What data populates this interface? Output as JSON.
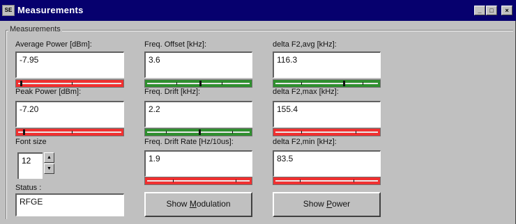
{
  "window": {
    "title": "Measurements",
    "icon_name": "app-icon",
    "controls": [
      "minimize",
      "maximize",
      "close"
    ]
  },
  "group": {
    "label": "Measurements"
  },
  "col1": {
    "avg_power_label": "Average Power [dBm]:",
    "avg_power_value": "-7.95",
    "peak_power_label": "Peak Power [dBm]:",
    "peak_power_value": "-7.20",
    "font_size_label": "Font size",
    "font_size_value": "12",
    "status_label": "Status :",
    "status_value": "RFGE"
  },
  "col2": {
    "freq_offset_label": "Freq. Offset [kHz]:",
    "freq_offset_value": "3.6",
    "freq_drift_label": "Freq. Drift [kHz]:",
    "freq_drift_value": "2.2",
    "freq_drift_rate_label": "Freq. Drift Rate [Hz/10us]:",
    "freq_drift_rate_value": "1.9",
    "show_modulation_prefix": "Show ",
    "show_modulation_accel": "M",
    "show_modulation_suffix": "odulation"
  },
  "col3": {
    "delta_avg_label": "delta F2,avg [kHz]:",
    "delta_avg_value": "116.3",
    "delta_max_label": "delta F2,max [kHz]:",
    "delta_max_value": "155.4",
    "delta_min_label": "delta F2,min [kHz]:",
    "delta_min_value": "83.5",
    "show_power_prefix": "Show ",
    "show_power_accel": "P",
    "show_power_suffix": "ower"
  },
  "indicators": {
    "avg_power": {
      "status": "fail",
      "color": "#f03030",
      "level": 0.02
    },
    "peak_power": {
      "status": "fail",
      "color": "#f03030",
      "level": 0.03
    },
    "freq_offset": {
      "status": "pass",
      "color": "#2f8f2f",
      "level": 0.52
    },
    "freq_drift": {
      "status": "pass",
      "color": "#2f8f2f",
      "level": 0.51
    },
    "freq_drift_rate": {
      "status": "fail",
      "color": "#f03030"
    },
    "delta_avg": {
      "status": "pass",
      "color": "#2f8f2f",
      "level": 0.65
    },
    "delta_max": {
      "status": "fail",
      "color": "#f03030"
    },
    "delta_min": {
      "status": "fail",
      "color": "#f03030"
    }
  }
}
